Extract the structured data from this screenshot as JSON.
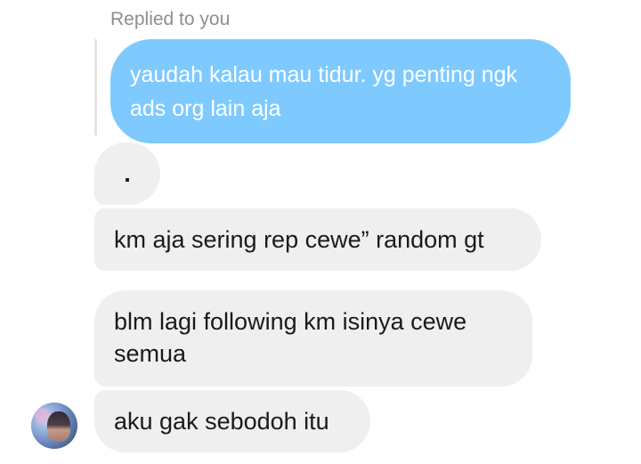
{
  "reply_header": {
    "label": "Replied to you"
  },
  "quoted_message": {
    "text": "yaudah kalau mau tidur. yg penting ngk ads org lain aja",
    "color": "#7ecaff"
  },
  "messages": [
    {
      "text": "."
    },
    {
      "text": "km aja sering rep cewe” random gt"
    },
    {
      "text": "blm lagi following km isinya cewe semua"
    },
    {
      "text": "aku gak sebodoh itu"
    }
  ],
  "colors": {
    "incoming_bubble": "#efefef",
    "secondary_text": "#8e8e8e"
  },
  "avatar": {
    "icon": "user-avatar-photo"
  }
}
